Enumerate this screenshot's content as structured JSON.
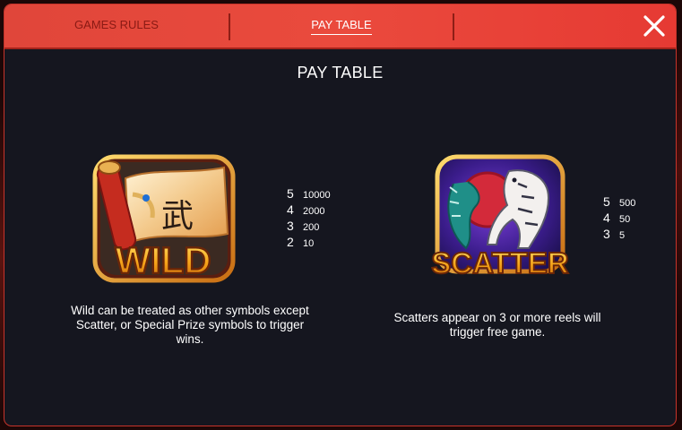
{
  "tabs": [
    {
      "label": "GAMES RULES",
      "active": false
    },
    {
      "label": "PAY TABLE",
      "active": true
    }
  ],
  "close_icon": "close-icon",
  "page_title": "PAY TABLE",
  "wild": {
    "symbol_text": "WILD",
    "glyph": "武",
    "payouts": [
      {
        "count": "5",
        "value": "10000"
      },
      {
        "count": "4",
        "value": "2000"
      },
      {
        "count": "3",
        "value": "200"
      },
      {
        "count": "2",
        "value": "10"
      }
    ],
    "description": "Wild can be treated as other symbols except Scatter, or Special Prize symbols to trigger wins."
  },
  "scatter": {
    "symbol_text": "SCATTER",
    "payouts": [
      {
        "count": "5",
        "value": "500"
      },
      {
        "count": "4",
        "value": "50"
      },
      {
        "count": "3",
        "value": "5"
      }
    ],
    "description": "Scatters appear on 3 or more reels will trigger free game."
  },
  "colors": {
    "tab_bar": "#e64236",
    "panel_bg": "#15161f",
    "symbol_gold": "#f2b21b"
  }
}
